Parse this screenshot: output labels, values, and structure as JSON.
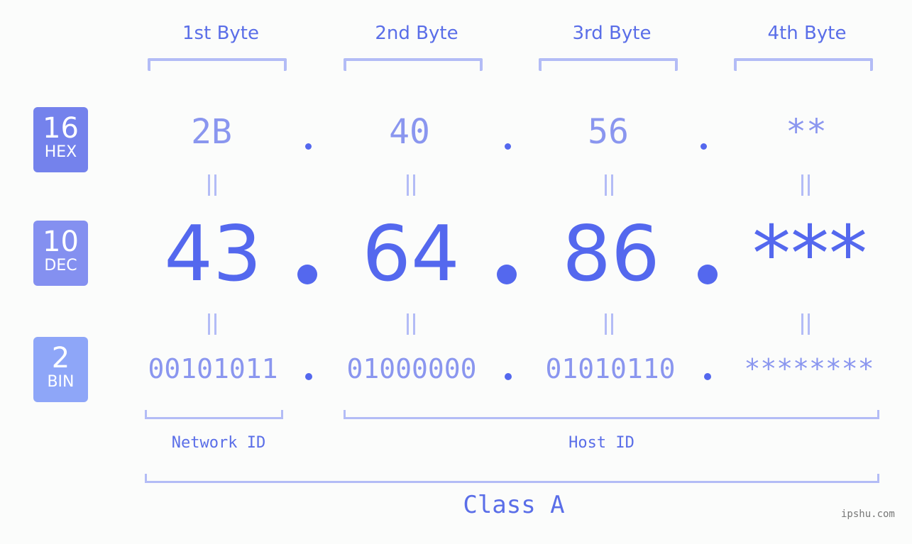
{
  "badges": [
    {
      "number": "16",
      "label": "HEX",
      "color": "#7482ec"
    },
    {
      "number": "10",
      "label": "DEC",
      "color": "#8490f0"
    },
    {
      "number": "2",
      "label": "BIN",
      "color": "#8ea6f8"
    }
  ],
  "byte_headers": [
    "1st Byte",
    "2nd Byte",
    "3rd Byte",
    "4th Byte"
  ],
  "hex": [
    "2B",
    "40",
    "56",
    "**"
  ],
  "dec": [
    "43",
    "64",
    "86",
    "***"
  ],
  "bin": [
    "00101011",
    "01000000",
    "01010110",
    "********"
  ],
  "network_label": "Network ID",
  "host_label": "Host ID",
  "class_label": "Class A",
  "watermark": "ipshu.com"
}
